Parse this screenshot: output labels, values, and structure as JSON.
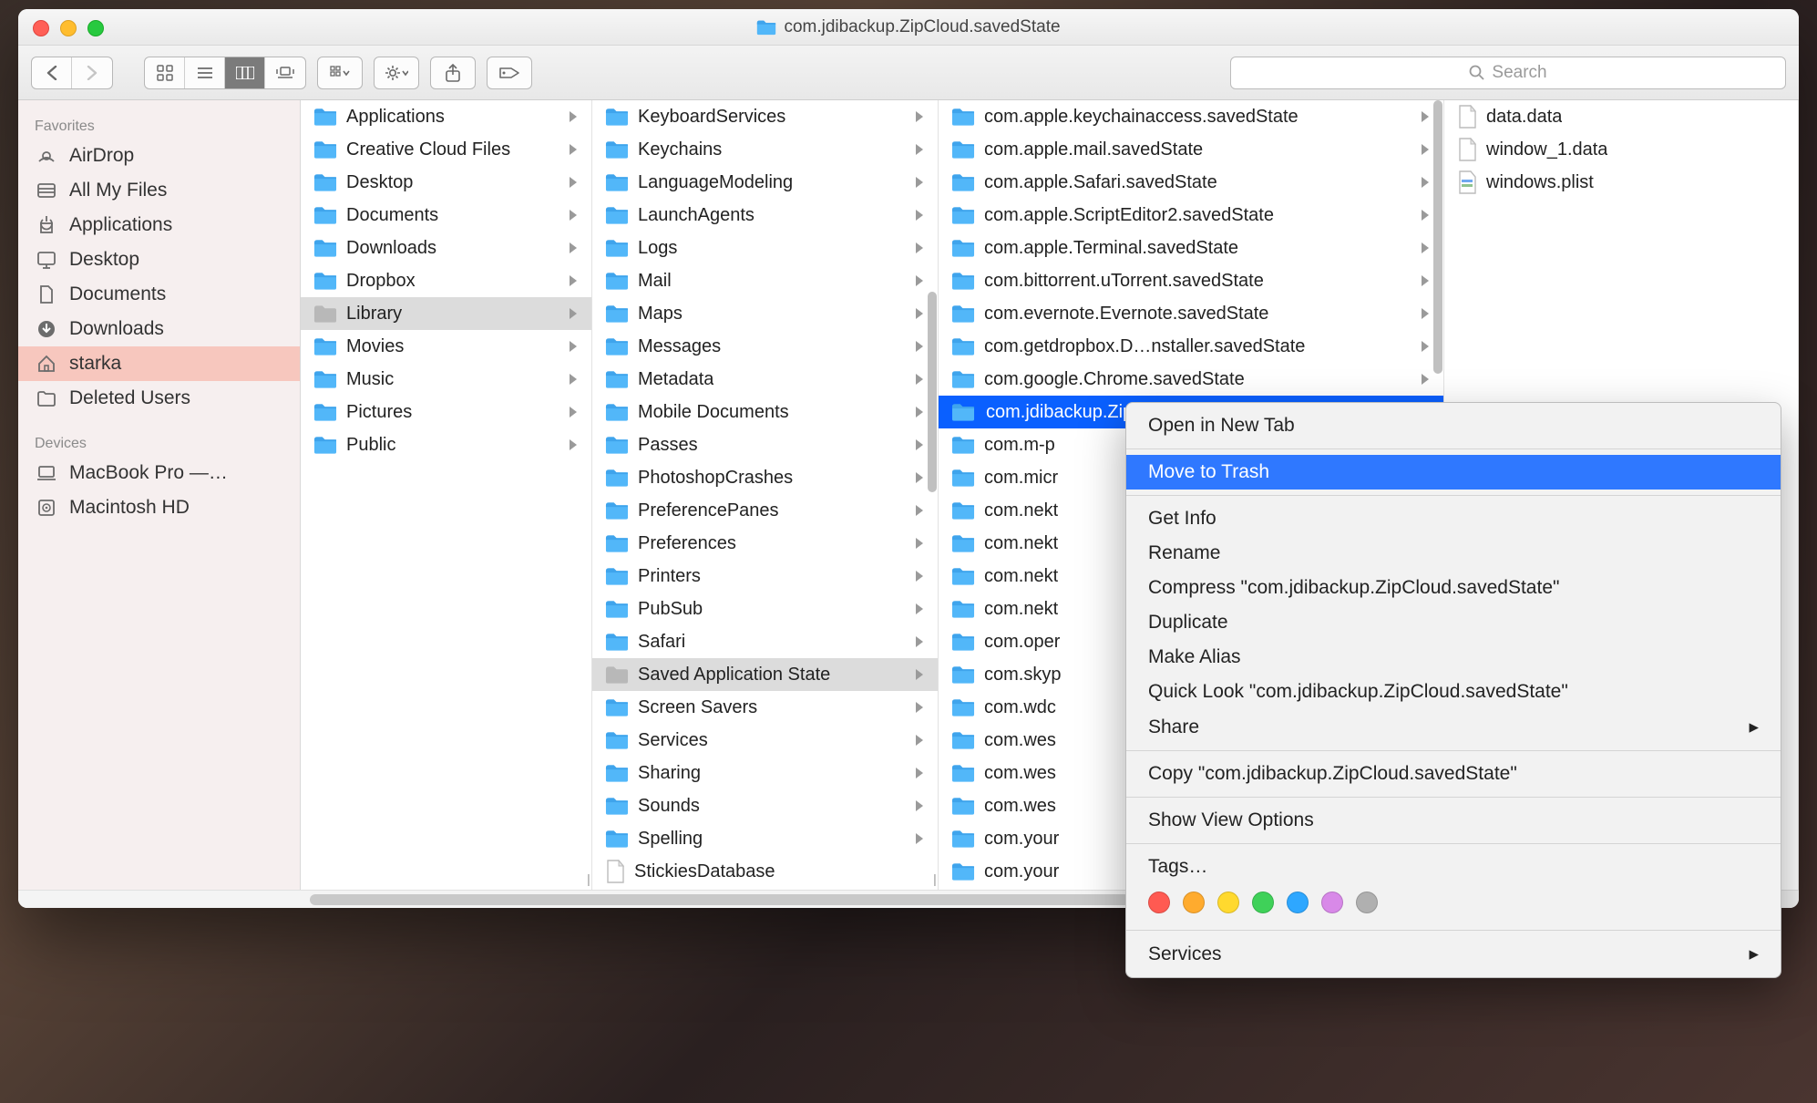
{
  "window": {
    "title": "com.jdibackup.ZipCloud.savedState"
  },
  "toolbar": {
    "search_placeholder": "Search"
  },
  "sidebar": {
    "favorites_header": "Favorites",
    "devices_header": "Devices",
    "favorites": [
      {
        "icon": "airdrop",
        "label": "AirDrop"
      },
      {
        "icon": "allfiles",
        "label": "All My Files"
      },
      {
        "icon": "apps",
        "label": "Applications"
      },
      {
        "icon": "desktop",
        "label": "Desktop"
      },
      {
        "icon": "documents",
        "label": "Documents"
      },
      {
        "icon": "downloads",
        "label": "Downloads"
      },
      {
        "icon": "home",
        "label": "starka",
        "selected": true
      },
      {
        "icon": "folder",
        "label": "Deleted Users"
      }
    ],
    "devices": [
      {
        "icon": "laptop",
        "label": "MacBook Pro —…"
      },
      {
        "icon": "disk",
        "label": "Macintosh HD"
      }
    ]
  },
  "columns": [
    {
      "items": [
        {
          "type": "folder",
          "label": "Applications"
        },
        {
          "type": "folder",
          "label": "Creative Cloud Files"
        },
        {
          "type": "folder",
          "label": "Desktop"
        },
        {
          "type": "folder",
          "label": "Documents"
        },
        {
          "type": "folder",
          "label": "Downloads"
        },
        {
          "type": "folder",
          "label": "Dropbox"
        },
        {
          "type": "folder",
          "label": "Library",
          "selected": true
        },
        {
          "type": "folder",
          "label": "Movies"
        },
        {
          "type": "folder",
          "label": "Music"
        },
        {
          "type": "folder",
          "label": "Pictures"
        },
        {
          "type": "folder",
          "label": "Public"
        }
      ]
    },
    {
      "items": [
        {
          "type": "folder",
          "label": "KeyboardServices"
        },
        {
          "type": "folder",
          "label": "Keychains"
        },
        {
          "type": "folder",
          "label": "LanguageModeling"
        },
        {
          "type": "folder",
          "label": "LaunchAgents"
        },
        {
          "type": "folder",
          "label": "Logs"
        },
        {
          "type": "folder",
          "label": "Mail"
        },
        {
          "type": "folder",
          "label": "Maps"
        },
        {
          "type": "folder",
          "label": "Messages"
        },
        {
          "type": "folder",
          "label": "Metadata"
        },
        {
          "type": "folder",
          "label": "Mobile Documents"
        },
        {
          "type": "folder",
          "label": "Passes"
        },
        {
          "type": "folder",
          "label": "PhotoshopCrashes"
        },
        {
          "type": "folder",
          "label": "PreferencePanes"
        },
        {
          "type": "folder",
          "label": "Preferences"
        },
        {
          "type": "folder",
          "label": "Printers"
        },
        {
          "type": "folder",
          "label": "PubSub"
        },
        {
          "type": "folder",
          "label": "Safari"
        },
        {
          "type": "folder",
          "label": "Saved Application State",
          "selected": true
        },
        {
          "type": "folder",
          "label": "Screen Savers"
        },
        {
          "type": "folder",
          "label": "Services"
        },
        {
          "type": "folder",
          "label": "Sharing"
        },
        {
          "type": "folder",
          "label": "Sounds"
        },
        {
          "type": "folder",
          "label": "Spelling"
        },
        {
          "type": "file",
          "label": "StickiesDatabase"
        }
      ]
    },
    {
      "items": [
        {
          "type": "folder",
          "label": "com.apple.keychainaccess.savedState"
        },
        {
          "type": "folder",
          "label": "com.apple.mail.savedState"
        },
        {
          "type": "folder",
          "label": "com.apple.Safari.savedState"
        },
        {
          "type": "folder",
          "label": "com.apple.ScriptEditor2.savedState"
        },
        {
          "type": "folder",
          "label": "com.apple.Terminal.savedState"
        },
        {
          "type": "folder",
          "label": "com.bittorrent.uTorrent.savedState"
        },
        {
          "type": "folder",
          "label": "com.evernote.Evernote.savedState"
        },
        {
          "type": "folder",
          "label": "com.getdropbox.D…nstaller.savedState"
        },
        {
          "type": "folder",
          "label": "com.google.Chrome.savedState"
        },
        {
          "type": "folder",
          "label": "com.jdibackup.ZipCloud.savedState",
          "highlight": true,
          "cut": true
        },
        {
          "type": "folder",
          "label": "com.m-p",
          "cut": true
        },
        {
          "type": "folder",
          "label": "com.micr",
          "cut": true
        },
        {
          "type": "folder",
          "label": "com.nekt",
          "cut": true
        },
        {
          "type": "folder",
          "label": "com.nekt",
          "cut": true
        },
        {
          "type": "folder",
          "label": "com.nekt",
          "cut": true
        },
        {
          "type": "folder",
          "label": "com.nekt",
          "cut": true
        },
        {
          "type": "folder",
          "label": "com.oper",
          "cut": true
        },
        {
          "type": "folder",
          "label": "com.skyp",
          "cut": true
        },
        {
          "type": "folder",
          "label": "com.wdc",
          "cut": true
        },
        {
          "type": "folder",
          "label": "com.wes",
          "cut": true
        },
        {
          "type": "folder",
          "label": "com.wes",
          "cut": true
        },
        {
          "type": "folder",
          "label": "com.wes",
          "cut": true
        },
        {
          "type": "folder",
          "label": "com.your",
          "cut": true
        },
        {
          "type": "folder",
          "label": "com.your",
          "cut": true
        }
      ]
    },
    {
      "items": [
        {
          "type": "file",
          "label": "data.data"
        },
        {
          "type": "file",
          "label": "window_1.data"
        },
        {
          "type": "plist",
          "label": "windows.plist"
        }
      ]
    }
  ],
  "context_menu": {
    "open_new_tab": "Open in New Tab",
    "move_to_trash": "Move to Trash",
    "get_info": "Get Info",
    "rename": "Rename",
    "compress": "Compress \"com.jdibackup.ZipCloud.savedState\"",
    "duplicate": "Duplicate",
    "make_alias": "Make Alias",
    "quick_look": "Quick Look \"com.jdibackup.ZipCloud.savedState\"",
    "share": "Share",
    "copy": "Copy \"com.jdibackup.ZipCloud.savedState\"",
    "show_view_options": "Show View Options",
    "tags": "Tags…",
    "services": "Services",
    "tag_colors": [
      "#ff5a52",
      "#ffab2e",
      "#ffd92e",
      "#3fd159",
      "#2ea7ff",
      "#d889e8",
      "#b0b0b0"
    ]
  }
}
